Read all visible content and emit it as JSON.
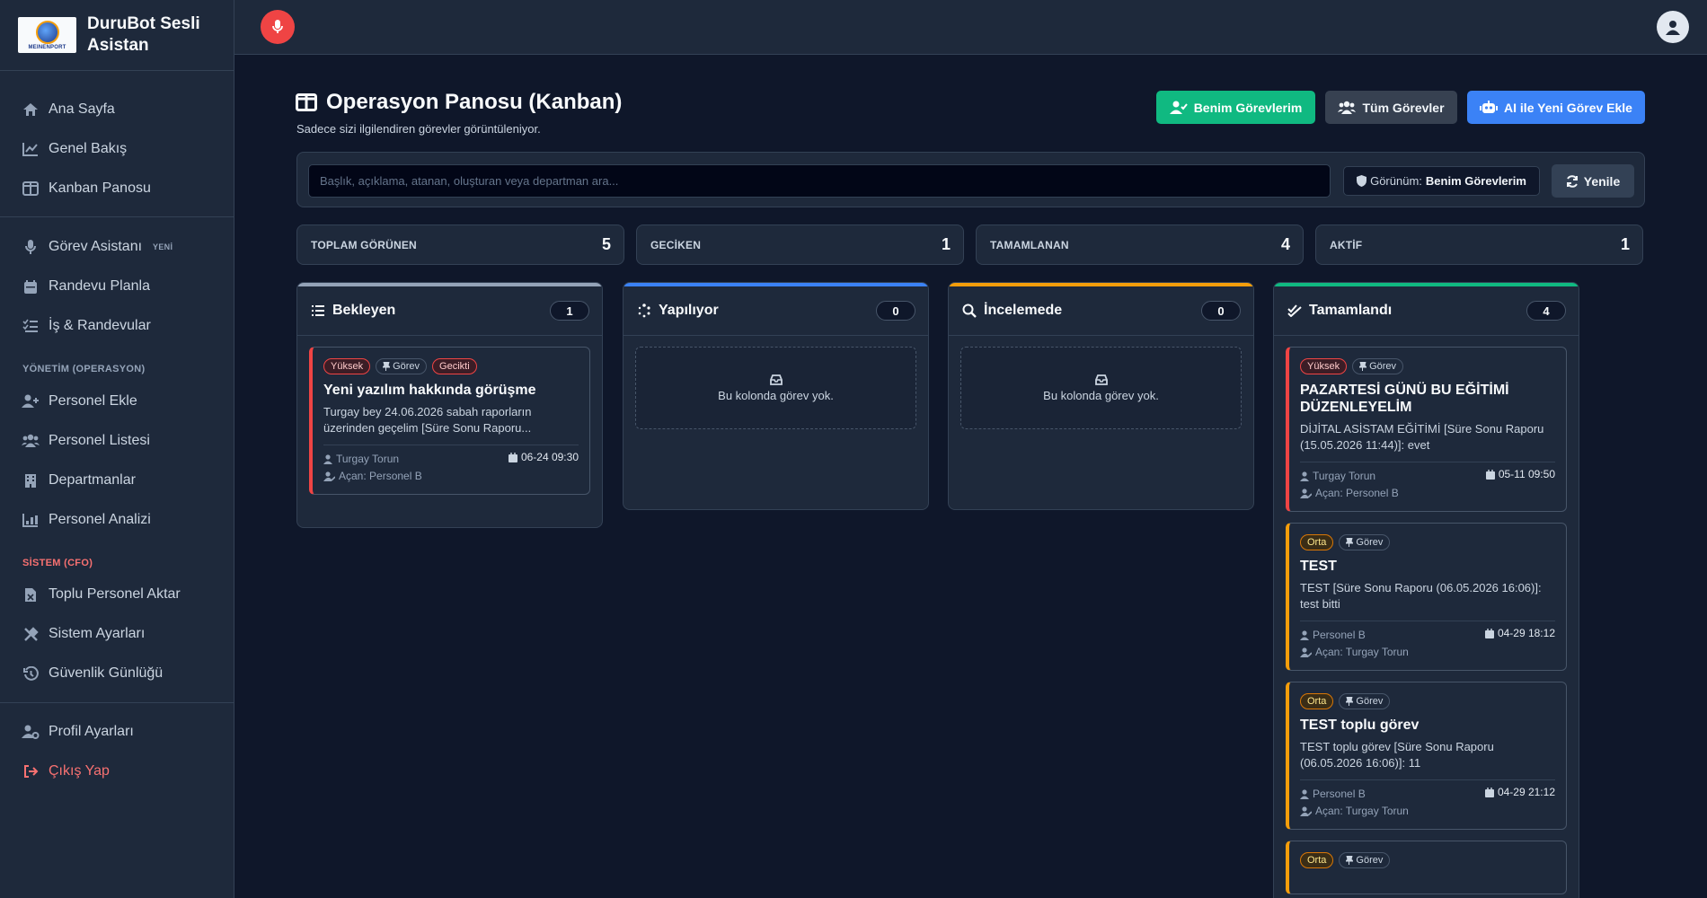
{
  "brand": {
    "title": "DuruBot Sesli Asistan",
    "logo_text": "MEINENPORT"
  },
  "sidebar": {
    "items": [
      {
        "label": "Ana Sayfa"
      },
      {
        "label": "Genel Bakış"
      },
      {
        "label": "Kanban Panosu"
      },
      {
        "label": "Görev Asistanı",
        "badge": "YENİ"
      },
      {
        "label": "Randevu Planla"
      },
      {
        "label": "İş & Randevular"
      },
      {
        "label": "Personel Ekle"
      },
      {
        "label": "Personel Listesi"
      },
      {
        "label": "Departmanlar"
      },
      {
        "label": "Personel Analizi"
      },
      {
        "label": "Toplu Personel Aktar"
      },
      {
        "label": "Sistem Ayarları"
      },
      {
        "label": "Güvenlik Günlüğü"
      },
      {
        "label": "Profil Ayarları"
      },
      {
        "label": "Çıkış Yap"
      }
    ],
    "sections": {
      "ops": "YÖNETİM (OPERASYON)",
      "system": "SİSTEM (CFO)"
    }
  },
  "header": {
    "title": "Operasyon Panosu (Kanban)",
    "subtitle": "Sadece sizi ilgilendiren görevler görüntüleniyor.",
    "btn_mine": "Benim Görevlerim",
    "btn_all": "Tüm Görevler",
    "btn_ai": "AI ile Yeni Görev Ekle"
  },
  "search": {
    "placeholder": "Başlık, açıklama, atanan, oluşturan veya departman ara...",
    "view_label": "Görünüm:",
    "view_value": "Benim Görevlerim",
    "refresh": "Yenile"
  },
  "stats": [
    {
      "label": "TOPLAM GÖRÜNEN",
      "value": "5"
    },
    {
      "label": "GECİKEN",
      "value": "1"
    },
    {
      "label": "TAMAMLANAN",
      "value": "4"
    },
    {
      "label": "AKTİF",
      "value": "1"
    }
  ],
  "columns": {
    "pending": {
      "title": "Bekleyen",
      "count": "1"
    },
    "doing": {
      "title": "Yapılıyor",
      "count": "0",
      "empty": "Bu kolonda görev yok."
    },
    "review": {
      "title": "İncelemede",
      "count": "0",
      "empty": "Bu kolonda görev yok."
    },
    "done": {
      "title": "Tamamlandı",
      "count": "4"
    }
  },
  "cards": {
    "p1": {
      "tags": [
        "Yüksek",
        "Görev",
        "Gecikti"
      ],
      "title": "Yeni yazılım hakkında görüşme",
      "desc": "Turgay bey 24.06.2026 sabah raporların üzerinden geçelim [Süre Sonu Raporu...",
      "assignee": "Turgay Torun",
      "opener": "Açan: Personel B",
      "date": "06-24 09:30"
    },
    "d1": {
      "tags": [
        "Yüksek",
        "Görev"
      ],
      "title": "PAZARTESİ GÜNÜ BU EĞİTİMİ DÜZENLEYELİM",
      "desc": "DİJİTAL ASİSTAM EĞİTİMİ [Süre Sonu Raporu (15.05.2026 11:44)]: evet",
      "assignee": "Turgay Torun",
      "opener": "Açan: Personel B",
      "date": "05-11 09:50"
    },
    "d2": {
      "tags": [
        "Orta",
        "Görev"
      ],
      "title": "TEST",
      "desc": "TEST [Süre Sonu Raporu (06.05.2026 16:06)]: test bitti",
      "assignee": "Personel B",
      "opener": "Açan: Turgay Torun",
      "date": "04-29 18:12"
    },
    "d3": {
      "tags": [
        "Orta",
        "Görev"
      ],
      "title": "TEST toplu görev",
      "desc": "TEST toplu görev [Süre Sonu Raporu (06.05.2026 16:06)]: 11",
      "assignee": "Personel B",
      "opener": "Açan: Turgay Torun",
      "date": "04-29 21:12"
    },
    "d4": {
      "tags": [
        "Orta",
        "Görev"
      ]
    }
  },
  "colors": {
    "accent_green": "#10b981",
    "accent_blue": "#3b82f6",
    "danger": "#ef4444",
    "warning": "#f59e0b"
  }
}
